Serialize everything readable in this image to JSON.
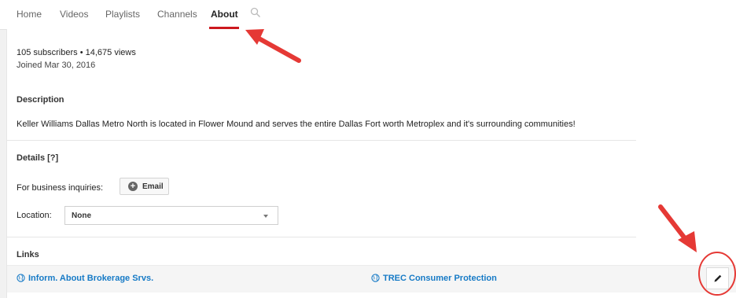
{
  "tabs": [
    {
      "label": "Home"
    },
    {
      "label": "Videos"
    },
    {
      "label": "Playlists"
    },
    {
      "label": "Channels"
    },
    {
      "label": "About"
    }
  ],
  "stats": {
    "line": "105 subscribers • 14,675 views",
    "joined": "Joined Mar 30, 2016"
  },
  "description": {
    "title": "Description",
    "text": "Keller Williams Dallas Metro North is located in Flower Mound and serves the entire Dallas Fort worth Metroplex and it's surrounding communities!"
  },
  "details": {
    "title": "Details [?]",
    "business_label": "For business inquiries:",
    "email_label": "Email",
    "location_label": "Location:",
    "location_value": "None"
  },
  "links": {
    "title": "Links",
    "items": [
      {
        "label": "Inform. About Brokerage Srvs."
      },
      {
        "label": "TREC Consumer Protection"
      }
    ]
  },
  "colors": {
    "accent": "#cc181e",
    "link": "#167ac6",
    "annotation": "#e53935"
  },
  "icons": [
    "search-icon",
    "plus-circle-icon",
    "chevron-down-icon",
    "globe-icon",
    "pencil-icon"
  ]
}
